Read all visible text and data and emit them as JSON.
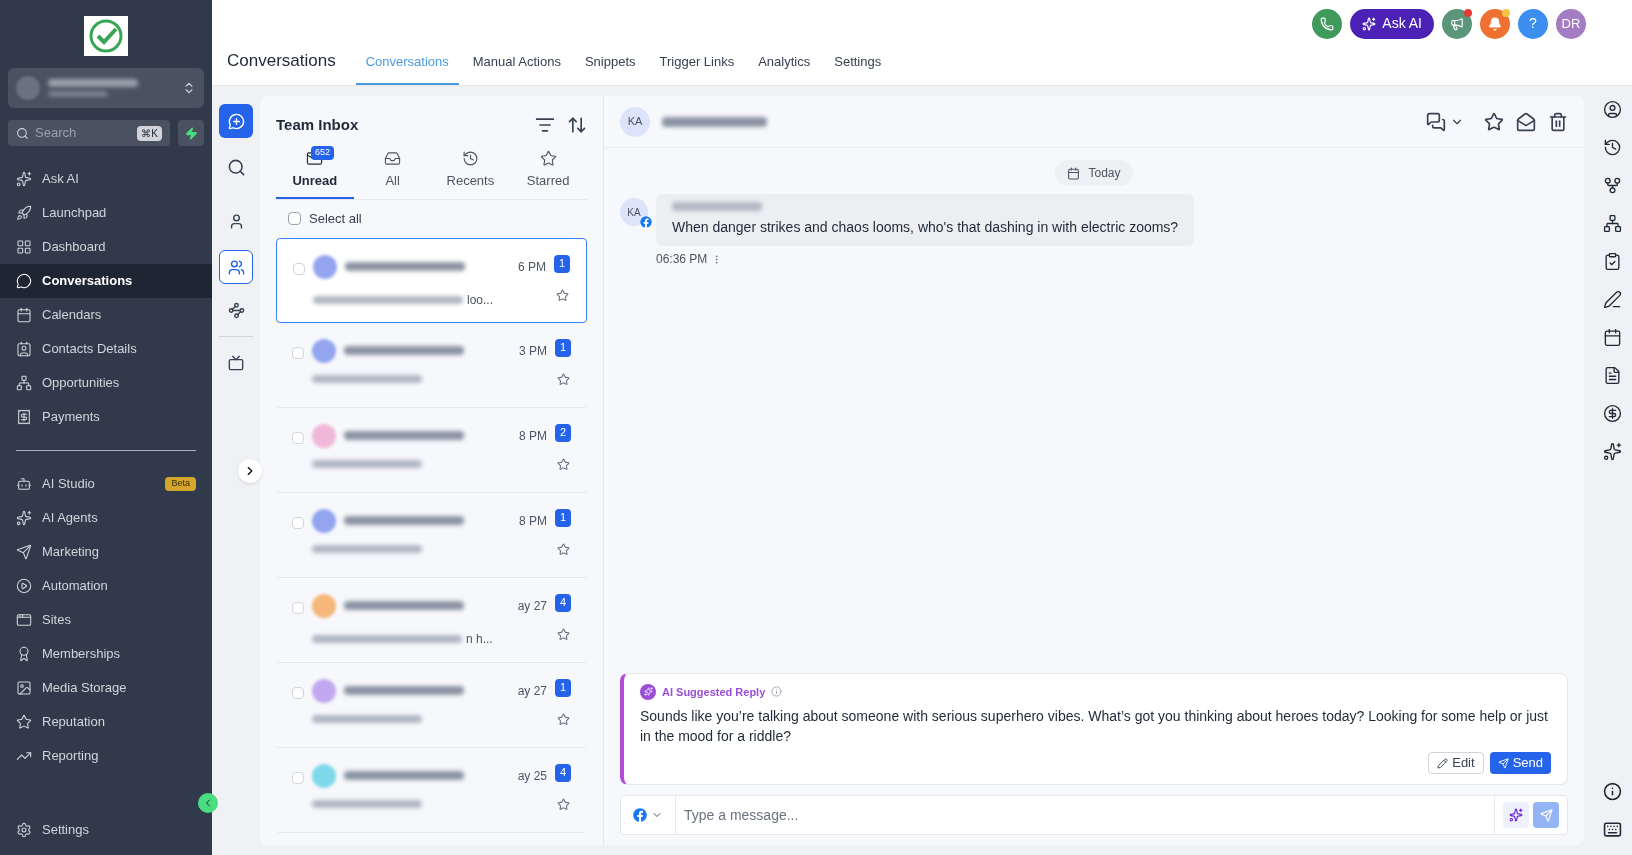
{
  "sidebar": {
    "search": {
      "placeholder": "Search",
      "shortcut": "⌘K"
    },
    "nav_primary": [
      {
        "label": "Ask AI",
        "selected": false
      },
      {
        "label": "Launchpad",
        "selected": false
      },
      {
        "label": "Dashboard",
        "selected": false
      },
      {
        "label": "Conversations",
        "selected": true
      },
      {
        "label": "Calendars",
        "selected": false
      },
      {
        "label": "Contacts Details",
        "selected": false
      },
      {
        "label": "Opportunities",
        "selected": false
      },
      {
        "label": "Payments",
        "selected": false
      }
    ],
    "nav_secondary": [
      {
        "label": "AI Studio",
        "badge": "Beta",
        "selected": false
      },
      {
        "label": "AI Agents",
        "selected": false
      },
      {
        "label": "Marketing",
        "selected": false
      },
      {
        "label": "Automation",
        "selected": false
      },
      {
        "label": "Sites",
        "selected": false
      },
      {
        "label": "Memberships",
        "selected": false
      },
      {
        "label": "Media Storage",
        "selected": false
      },
      {
        "label": "Reputation",
        "selected": false
      },
      {
        "label": "Reporting",
        "selected": false
      }
    ],
    "footer": {
      "label": "Settings"
    }
  },
  "header": {
    "title": "Conversations",
    "tabs": [
      {
        "label": "Conversations",
        "selected": true
      },
      {
        "label": "Manual Actions",
        "selected": false
      },
      {
        "label": "Snippets",
        "selected": false
      },
      {
        "label": "Trigger Links",
        "selected": false
      },
      {
        "label": "Analytics",
        "selected": false
      },
      {
        "label": "Settings",
        "selected": false
      }
    ],
    "ask_ai": "Ask AI",
    "help": "?",
    "avatar": "DR"
  },
  "inbox": {
    "title": "Team Inbox",
    "tabs": [
      {
        "label": "Unread",
        "count": "652",
        "selected": true
      },
      {
        "label": "All",
        "selected": false
      },
      {
        "label": "Recents",
        "selected": false
      },
      {
        "label": "Starred",
        "selected": false
      }
    ],
    "select_all": {
      "label": "Select all",
      "checked": false
    },
    "conversations": [
      {
        "time": "6 PM",
        "unread": "1",
        "preview_end": "loo...",
        "color": "#93a5f0",
        "selected": true
      },
      {
        "time": "3 PM",
        "unread": "1",
        "color": "#93a5f0",
        "selected": false
      },
      {
        "time": "8 PM",
        "unread": "2",
        "color": "#f0b8d8",
        "selected": false
      },
      {
        "time": "8 PM",
        "unread": "1",
        "color": "#93a5f0",
        "selected": false
      },
      {
        "time": "ay 27",
        "unread": "4",
        "preview_end": "n h...",
        "color": "#f5b77a",
        "selected": false
      },
      {
        "time": "ay 27",
        "unread": "1",
        "color": "#c2a8f0",
        "selected": false
      },
      {
        "time": "ay 25",
        "unread": "4",
        "color": "#7fd9ea",
        "selected": false
      }
    ]
  },
  "chat": {
    "contact_initials": "KA",
    "date_chip": "Today",
    "messages": [
      {
        "initials": "KA",
        "text": "When danger strikes and chaos looms, who's that dashing in with electric zooms?",
        "time": "06:36 PM"
      }
    ],
    "ai_reply": {
      "title": "AI Suggested Reply",
      "text": "Sounds like you’re talking about someone with serious superhero vibes. What’s got you thinking about heroes today? Looking for some help or just in the mood for a riddle?",
      "edit": "Edit",
      "send": "Send"
    },
    "composer": {
      "placeholder": "Type a message..."
    }
  }
}
